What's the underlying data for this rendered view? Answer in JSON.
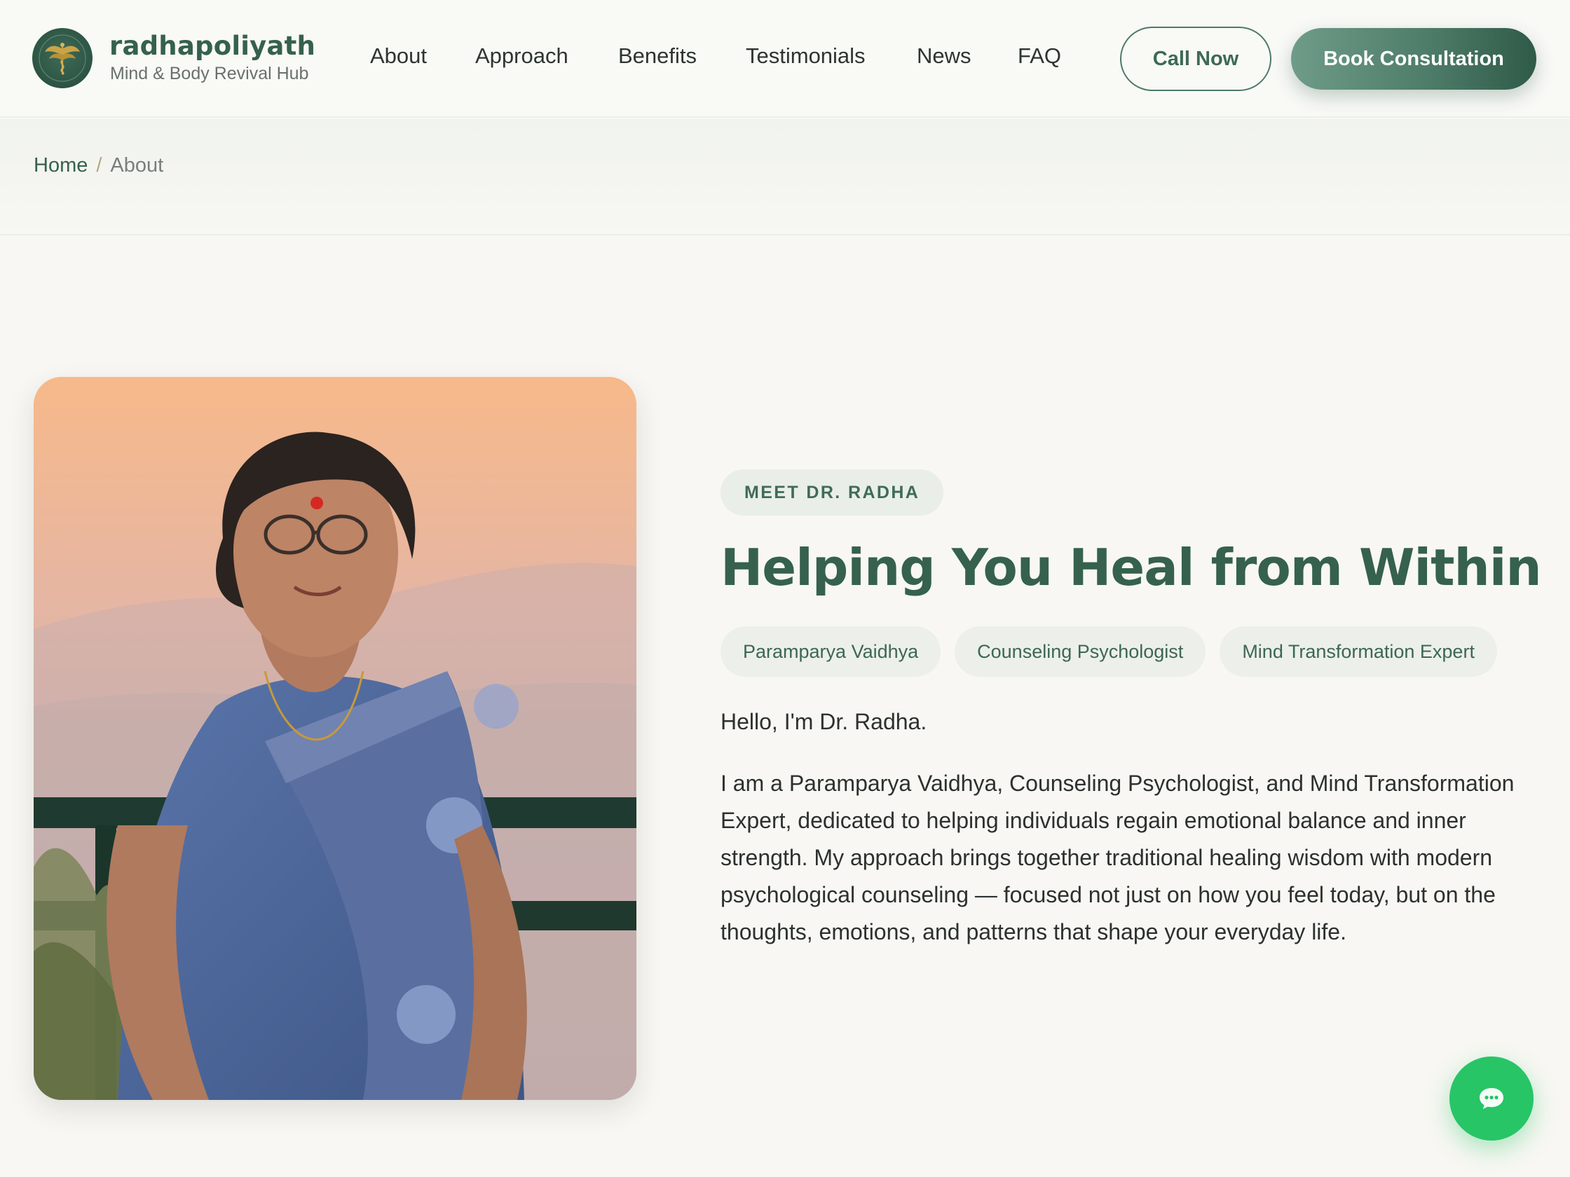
{
  "brand": {
    "name": "radhapoliyath",
    "tagline": "Mind & Body Revival Hub"
  },
  "nav": {
    "items": [
      {
        "label": "About"
      },
      {
        "label": "Approach"
      },
      {
        "label": "Benefits"
      },
      {
        "label": "Testimonials"
      },
      {
        "label": "News"
      },
      {
        "label": "FAQ"
      }
    ],
    "call_label": "Call Now",
    "book_label": "Book Consultation"
  },
  "breadcrumb": {
    "home": "Home",
    "separator": "/",
    "current": "About"
  },
  "hero": {
    "eyebrow": "MEET DR. RADHA",
    "headline": "Helping You Heal from Within",
    "tags": [
      "Paramparya Vaidhya",
      "Counseling Psychologist",
      "Mind Transformation Expert"
    ],
    "greeting": "Hello, I'm Dr. Radha.",
    "bio": "I am a Paramparya Vaidhya, Counseling Psychologist, and Mind Transformation Expert, dedicated to helping individuals regain emotional balance and inner strength. My approach brings together traditional healing wisdom with modern psychological counseling — focused not just on how you feel today, but on the thoughts, emotions, and patterns that shape your everyday life."
  },
  "icons": {
    "logo": "winged-caduceus-icon",
    "chat": "chat-bubble-icon"
  },
  "colors": {
    "brand_green": "#35614d",
    "button_gradient_start": "#6f9c88",
    "button_gradient_end": "#2f5a48",
    "chat_green": "#27c566",
    "page_bg": "#f8f7f3"
  }
}
